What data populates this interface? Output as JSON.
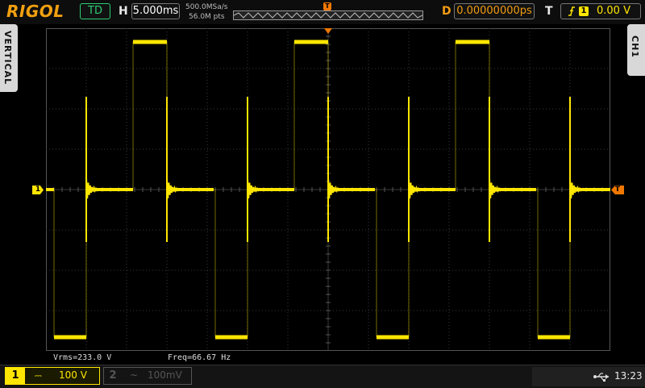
{
  "brand": "RIGOL",
  "status": {
    "mode": "TD"
  },
  "horizontal": {
    "label": "H",
    "timebase": "5.000ms",
    "sample_rate": "500.0MSa/s",
    "memory_depth": "56.0M pts"
  },
  "delay": {
    "label": "D",
    "value": "0.00000000ps"
  },
  "trigger": {
    "label": "T",
    "source_badge": "1",
    "level": "0.00 V",
    "edge_icon": "rising-edge-icon"
  },
  "side_labels": {
    "left": "VERTICAL",
    "right": "CH1"
  },
  "markers": {
    "ch1_ground": "1",
    "trigger_level": "T",
    "trigger_position": "T"
  },
  "measurements": {
    "vrms": "Vrms=233.0 V",
    "freq": "Freq=66.67 Hz"
  },
  "channels": [
    {
      "number": "1",
      "coupling_icon": "dc-coupling-icon",
      "scale": "100 V",
      "color": "#ffe600"
    },
    {
      "number": "2",
      "coupling_icon": "ac-coupling-icon",
      "scale": "100mV",
      "color": "#666666"
    }
  ],
  "system": {
    "usb_icon": "usb-icon",
    "time": "13:23"
  },
  "colors": {
    "trace": "#ffe600",
    "grid": "#3a3a3a",
    "accent": "#f39c12",
    "trigger": "#f07800"
  }
}
